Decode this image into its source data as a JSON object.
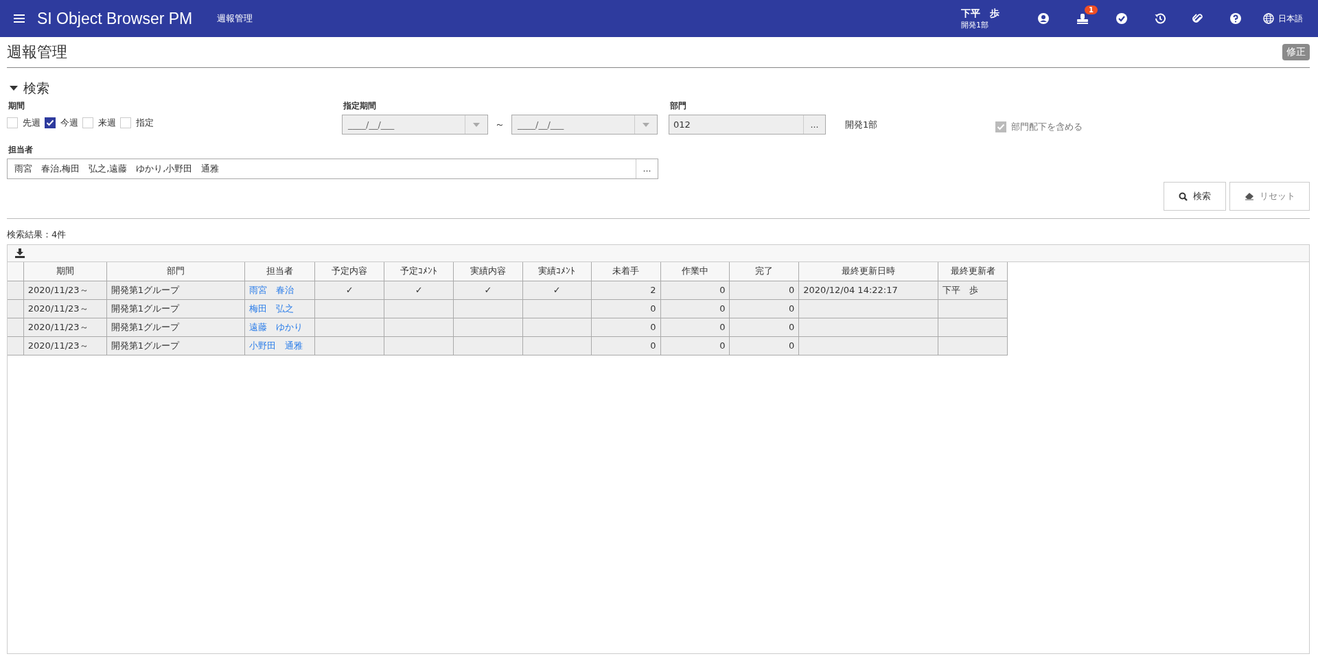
{
  "header": {
    "app_title": "SI Object Browser PM",
    "page_name": "週報管理",
    "user_name": "下平　歩",
    "user_dept": "開発1部",
    "notification_count": "1",
    "language": "日本語"
  },
  "page": {
    "title": "週報管理",
    "edit_button": "修正"
  },
  "search": {
    "heading": "検索",
    "expanded": true,
    "period": {
      "label": "期間",
      "options": [
        {
          "label": "先週",
          "checked": false
        },
        {
          "label": "今週",
          "checked": true
        },
        {
          "label": "来週",
          "checked": false
        },
        {
          "label": "指定",
          "checked": false
        }
      ]
    },
    "date_range": {
      "label": "指定期間",
      "from_placeholder": "____/__/___",
      "separator": "～",
      "to_placeholder": "____/__/___"
    },
    "department": {
      "label": "部門",
      "value": "012",
      "browse": "…",
      "name": "開発1部",
      "include_sub": {
        "label": "部門配下を含める",
        "checked": true,
        "disabled": true
      }
    },
    "assignee": {
      "label": "担当者",
      "value": "雨宮　春治,梅田　弘之,遠藤　ゆかり,小野田　通雅",
      "browse": "…"
    },
    "buttons": [
      {
        "kind": "search",
        "label": "検索",
        "disabled": false
      },
      {
        "kind": "reset",
        "label": "リセット",
        "disabled": true
      }
    ]
  },
  "results": {
    "summary": "検索結果：4件",
    "table": {
      "columns": [
        {
          "label": "期間",
          "kind": "text"
        },
        {
          "label": "部門",
          "kind": "text"
        },
        {
          "label": "担当者",
          "kind": "link"
        },
        {
          "label": "予定内容",
          "kind": "check"
        },
        {
          "label": "予定ｺﾒﾝﾄ",
          "kind": "check"
        },
        {
          "label": "実績内容",
          "kind": "check"
        },
        {
          "label": "実績ｺﾒﾝﾄ",
          "kind": "check"
        },
        {
          "label": "未着手",
          "kind": "number"
        },
        {
          "label": "作業中",
          "kind": "number"
        },
        {
          "label": "完了",
          "kind": "number"
        },
        {
          "label": "最終更新日時",
          "kind": "text"
        },
        {
          "label": "最終更新者",
          "kind": "text"
        }
      ],
      "rows": [
        [
          "2020/11/23～",
          "開発第1グループ",
          "雨宮　春治",
          "✓",
          "✓",
          "✓",
          "✓",
          "2",
          "0",
          "0",
          "2020/12/04 14:22:17",
          "下平　歩"
        ],
        [
          "2020/11/23～",
          "開発第1グループ",
          "梅田　弘之",
          "",
          "",
          "",
          "",
          "0",
          "0",
          "0",
          "",
          ""
        ],
        [
          "2020/11/23～",
          "開発第1グループ",
          "遠藤　ゆかり",
          "",
          "",
          "",
          "",
          "0",
          "0",
          "0",
          "",
          ""
        ],
        [
          "2020/11/23～",
          "開発第1グループ",
          "小野田　通雅",
          "",
          "",
          "",
          "",
          "0",
          "0",
          "0",
          "",
          ""
        ]
      ]
    }
  }
}
